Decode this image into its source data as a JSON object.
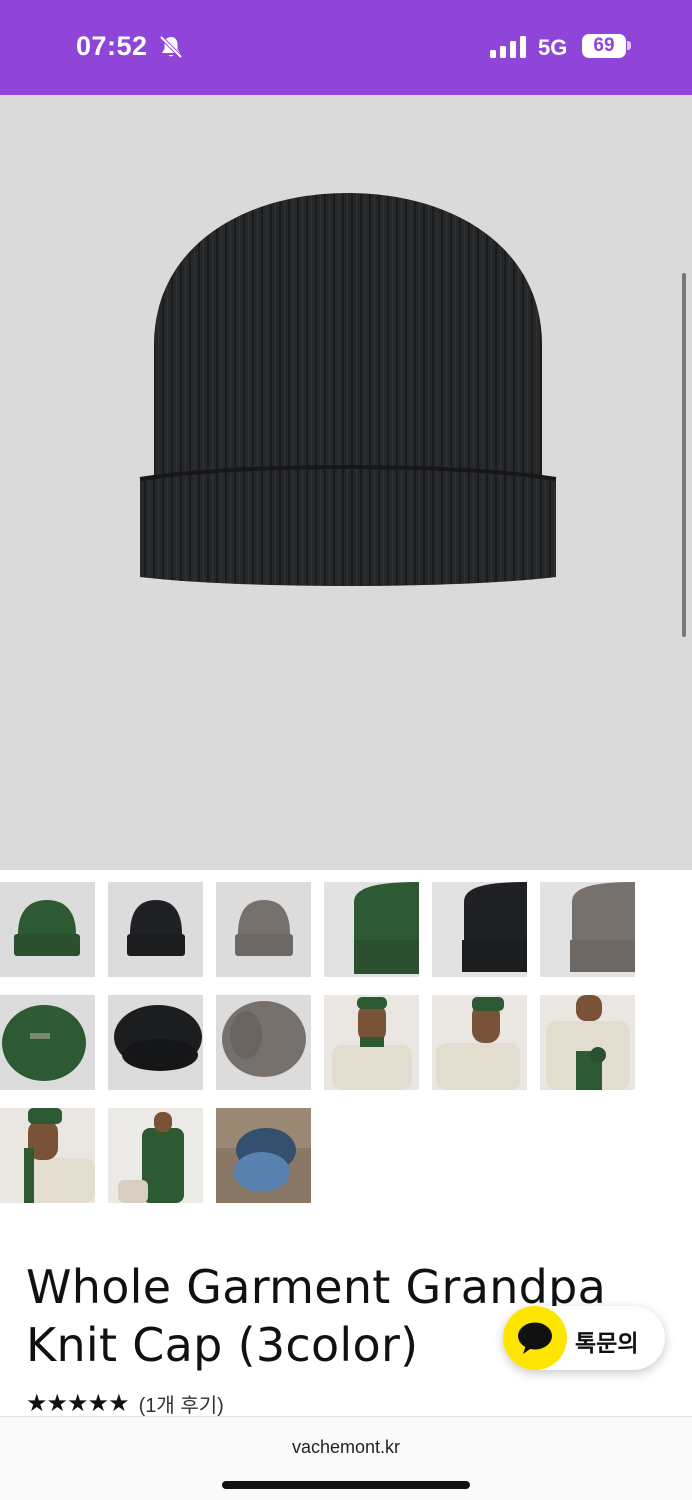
{
  "status_bar": {
    "time": "07:52",
    "bell_icon": "bell-slash-icon",
    "signal_icon": "signal-bars-icon",
    "network": "5G",
    "battery": "69"
  },
  "hero": {
    "image": "black-knit-beanie",
    "background": "#dadada"
  },
  "thumbnails": [
    "green-beanie",
    "black-beanie",
    "gray-beanie",
    "green-beanie-closeup",
    "black-beanie-closeup",
    "gray-beanie-closeup",
    "green-beanie-inside",
    "black-beanie-inside",
    "gray-beanie-inside",
    "model-green-front",
    "model-green-side",
    "model-green-gloves",
    "model-profile",
    "model-full-green",
    "blue-beanies-on-table"
  ],
  "product": {
    "title": "Whole Garment Grandpa Knit Cap (3color)",
    "stars": "★★★★★",
    "review_count": "(1개 후기)"
  },
  "chat_button": {
    "label": "톡문의",
    "icon": "kakao-talk-icon",
    "color": "#fee500"
  },
  "browser": {
    "url": "vachemont.kr"
  },
  "colors": {
    "status_bar": "#8f45d8",
    "green": "#2e5a33",
    "black": "#202124",
    "gray": "#77716d"
  }
}
